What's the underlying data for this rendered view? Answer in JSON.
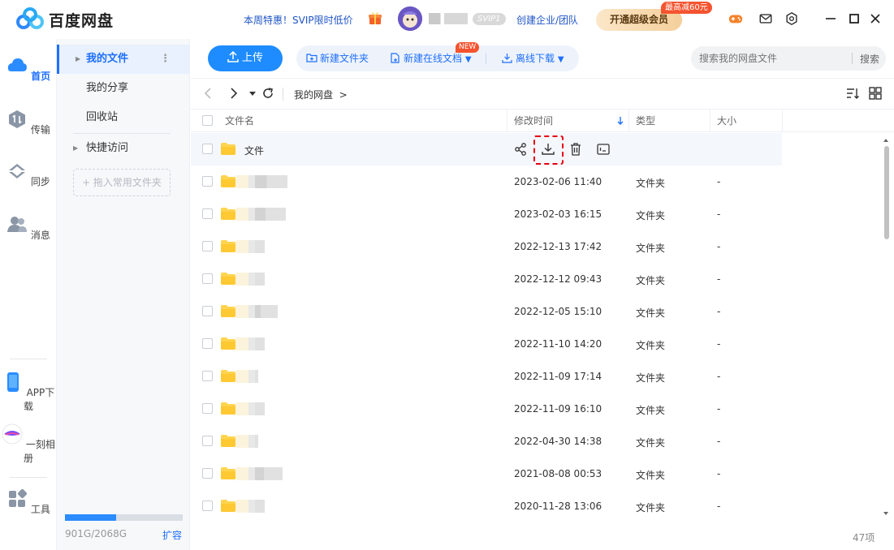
{
  "app": {
    "name": "百度网盘"
  },
  "header": {
    "promo": "本周特惠！SVIP限时低价",
    "svip_badge": "SVIP1",
    "corp": "创建企业/团队",
    "vip_button": "开通超级会员",
    "vip_tag": "最高减60元",
    "icons": [
      "game-icon",
      "mail-icon",
      "settings-icon"
    ],
    "window": [
      "minimize-icon",
      "maximize-icon",
      "close-icon"
    ]
  },
  "nav": [
    {
      "label": "首页",
      "icon": "cloud-icon",
      "active": true
    },
    {
      "label": "传输",
      "icon": "transfer-icon"
    },
    {
      "label": "同步",
      "icon": "sync-icon"
    },
    {
      "label": "消息",
      "icon": "message-icon"
    },
    {
      "label": "APP下载",
      "icon": "phone-icon"
    },
    {
      "label": "一刻相册",
      "icon": "album-icon"
    },
    {
      "label": "工具",
      "icon": "tools-icon"
    }
  ],
  "sidebar": {
    "items": [
      {
        "label": "我的文件",
        "active": true
      },
      {
        "label": "我的分享"
      },
      {
        "label": "回收站"
      },
      {
        "label": "快捷访问"
      }
    ],
    "drop_hint": "+ 拖入常用文件夹",
    "storage": {
      "text": "901G/2068G",
      "used_fraction": 0.436,
      "expand": "扩容"
    }
  },
  "toolbar": {
    "upload": "上传",
    "new_folder": "新建文件夹",
    "new_doc": "新建在线文档",
    "new_tag": "NEW",
    "offline": "离线下载",
    "search_placeholder": "搜索我的网盘文件",
    "search_btn": "搜索"
  },
  "path": {
    "crumb": "我的网盘",
    "sep": ">"
  },
  "table": {
    "headers": {
      "name": "文件名",
      "mtime": "修改时间",
      "type": "类型",
      "size": "大小"
    },
    "rows": [
      {
        "name": "文件",
        "mtime": "",
        "type": "",
        "size": "",
        "hover": true
      },
      {
        "name": "",
        "mtime": "2023-02-06 11:40",
        "type": "文件夹",
        "size": "-"
      },
      {
        "name": "",
        "mtime": "2023-02-03 16:15",
        "type": "文件夹",
        "size": "-"
      },
      {
        "name": "",
        "mtime": "2022-12-13 17:42",
        "type": "文件夹",
        "size": "-"
      },
      {
        "name": "",
        "mtime": "2022-12-12 09:43",
        "type": "文件夹",
        "size": "-"
      },
      {
        "name": "",
        "mtime": "2022-12-05 15:10",
        "type": "文件夹",
        "size": "-"
      },
      {
        "name": "",
        "mtime": "2022-11-10 14:20",
        "type": "文件夹",
        "size": "-"
      },
      {
        "name": "",
        "mtime": "2022-11-09 17:14",
        "type": "文件夹",
        "size": "-"
      },
      {
        "name": "",
        "mtime": "2022-11-09 16:10",
        "type": "文件夹",
        "size": "-"
      },
      {
        "name": "",
        "mtime": "2022-04-30 14:38",
        "type": "文件夹",
        "size": "-"
      },
      {
        "name": "",
        "mtime": "2021-08-08 00:53",
        "type": "文件夹",
        "size": "-"
      },
      {
        "name": "",
        "mtime": "2020-11-28 13:06",
        "type": "文件夹",
        "size": "-"
      }
    ],
    "count": "47项"
  }
}
